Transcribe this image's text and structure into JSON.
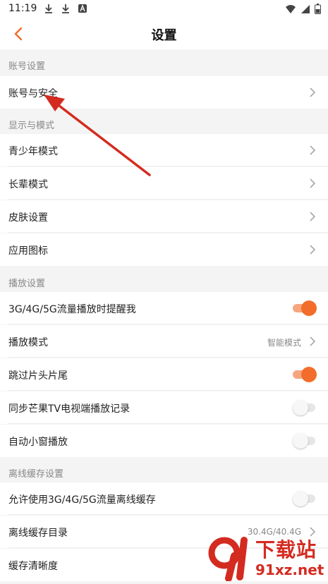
{
  "status_bar": {
    "time": "11:19",
    "icons": [
      "download-icon",
      "download-icon",
      "app-a-icon",
      "wifi-icon",
      "signal-icon",
      "battery-icon"
    ]
  },
  "header": {
    "title": "设置"
  },
  "sections": {
    "account": {
      "title": "账号设置"
    },
    "display": {
      "title": "显示与模式"
    },
    "playback": {
      "title": "播放设置"
    },
    "offline": {
      "title": "离线缓存设置"
    }
  },
  "rows": {
    "account_security": {
      "label": "账号与安全"
    },
    "teen_mode": {
      "label": "青少年模式"
    },
    "elder_mode": {
      "label": "长辈模式"
    },
    "skin_settings": {
      "label": "皮肤设置"
    },
    "app_icon": {
      "label": "应用图标"
    },
    "mobile_data_alert": {
      "label": "3G/4G/5G流量播放时提醒我",
      "enabled": true
    },
    "play_mode": {
      "label": "播放模式",
      "value": "智能模式"
    },
    "skip_intro_outro": {
      "label": "跳过片头片尾",
      "enabled": true
    },
    "sync_tv_history": {
      "label": "同步芒果TV电视端播放记录",
      "enabled": false
    },
    "auto_mini_window": {
      "label": "自动小窗播放",
      "enabled": false
    },
    "offline_mobile_data": {
      "label": "允许使用3G/4G/5G流量离线缓存",
      "enabled": false
    },
    "offline_cache_dir": {
      "label": "离线缓存目录",
      "value": "30.4G/40.4G"
    },
    "cache_quality": {
      "label": "缓存清晰度"
    }
  },
  "watermark": {
    "logo_icon": "91-logo-icon",
    "text": "下载站",
    "url": "91xz.net"
  },
  "colors": {
    "accent": "#f26d2b",
    "annotation": "#d42b20"
  }
}
